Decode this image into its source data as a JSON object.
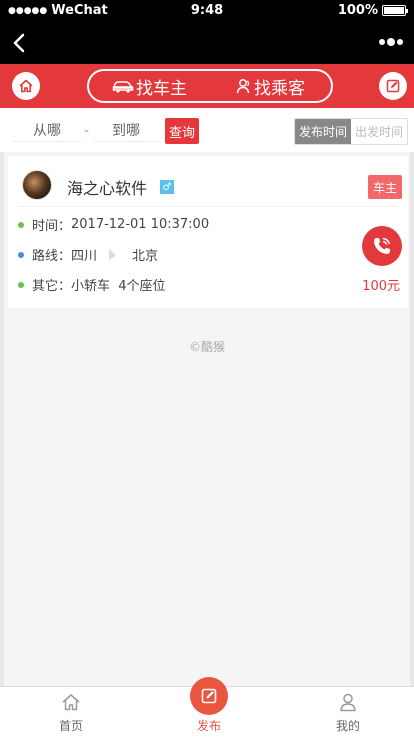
{
  "status_bar": {
    "carrier": "WeChat",
    "signal_dots": "●●●●●",
    "time": "9:48",
    "battery": "100%"
  },
  "nav": {
    "back_label": "",
    "more_label": ""
  },
  "header": {
    "tabs": [
      {
        "label": "找车主",
        "icon": "car-icon"
      },
      {
        "label": "找乘客",
        "icon": "person-icon"
      }
    ]
  },
  "filter": {
    "from_placeholder": "从哪",
    "separator": "-",
    "to_placeholder": "到哪",
    "query_label": "查询",
    "sort_options": [
      "发布时间",
      "出发时间"
    ],
    "active_sort": "发布时间"
  },
  "listing": {
    "user_name": "海之心软件",
    "gender_symbol": "♂",
    "role": "车主",
    "time_label": "时间：",
    "time_value": "2017-12-01 10:37:00",
    "route_label": "路线：",
    "route_from": "四川",
    "route_to": "北京",
    "other_label": "其它：",
    "other_value": "小轿车  4个座位",
    "price": "100元"
  },
  "footer": {
    "copyright": "©酷猴"
  },
  "tabbar": {
    "items": [
      {
        "label": "首页",
        "icon": "home-icon"
      },
      {
        "label": "发布",
        "icon": "edit-icon"
      },
      {
        "label": "我的",
        "icon": "user-icon"
      }
    ]
  },
  "colors": {
    "brand": "#e3393c",
    "post": "#e8563f",
    "gender": "#5bc0eb"
  }
}
